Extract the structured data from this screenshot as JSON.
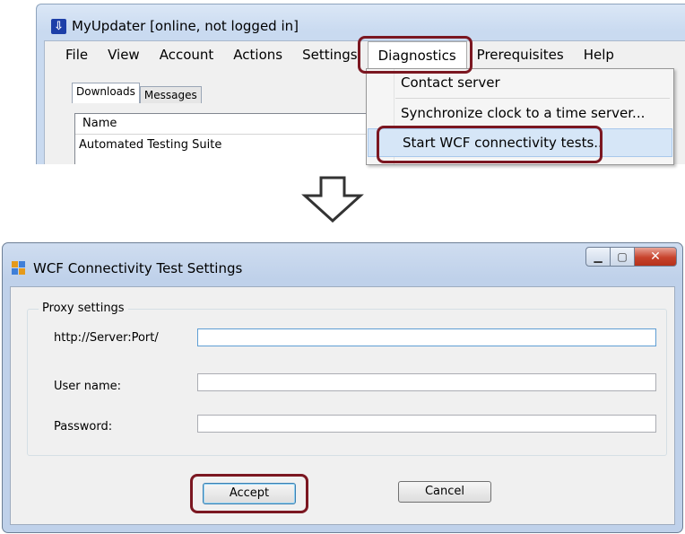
{
  "main_window": {
    "title": "MyUpdater [online, not logged in]",
    "menu": [
      "File",
      "View",
      "Account",
      "Actions",
      "Settings",
      "Diagnostics",
      "Prerequisites",
      "Help"
    ],
    "tabs": [
      "Downloads",
      "Messages"
    ],
    "table": {
      "column_header": "Name",
      "rows": [
        "Automated Testing Suite"
      ]
    },
    "diagnostics_menu": [
      "Contact server",
      "Synchronize clock to a time server...",
      "Start WCF connectivity tests.."
    ]
  },
  "dialog": {
    "title": "WCF Connectivity Test Settings",
    "group_title": "Proxy settings",
    "fields": [
      {
        "label": "http://Server:Port/",
        "value": ""
      },
      {
        "label": "User name:",
        "value": ""
      },
      {
        "label": "Password:",
        "value": ""
      }
    ],
    "accept_label": "Accept",
    "cancel_label": "Cancel"
  },
  "colors": {
    "highlight_box": "#7b1721",
    "menu_hover": "#d6e6f7"
  },
  "icons": {
    "transition_arrow": "down-arrow-icon"
  }
}
